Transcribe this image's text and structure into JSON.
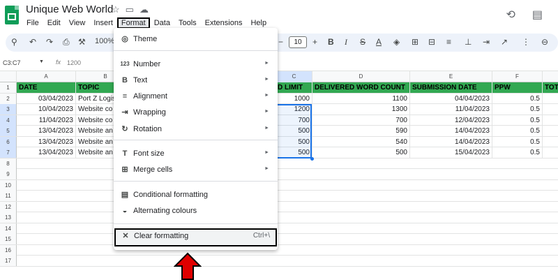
{
  "header": {
    "title": "Unique Web World",
    "menus": [
      "File",
      "Edit",
      "View",
      "Insert",
      "Format",
      "Data",
      "Tools",
      "Extensions",
      "Help"
    ],
    "active_menu": "Format"
  },
  "toolbar": {
    "zoom": "100%",
    "font_size": "10"
  },
  "formula_bar": {
    "name_box": "C3:C7",
    "fx": "fx",
    "value": "1200"
  },
  "grid": {
    "col_headers": [
      "A",
      "B",
      "C",
      "D",
      "E",
      "F"
    ],
    "row_numbers": [
      "1",
      "2",
      "3",
      "4",
      "5",
      "6",
      "7",
      "8",
      "9",
      "10",
      "11",
      "12",
      "13",
      "14",
      "15",
      "16",
      "17"
    ],
    "header_row": [
      "DATE",
      "TOPIC",
      "D LIMIT",
      "DELIVERED WORD COUNT",
      "SUBMISSION DATE",
      "PPW",
      "TOT"
    ],
    "rows": [
      [
        "03/04/2023",
        "Port Z Logis",
        "1000",
        "1100",
        "04/04/2023",
        "0.5"
      ],
      [
        "10/04/2023",
        "Website co",
        "1200",
        "1300",
        "11/04/2023",
        "0.5"
      ],
      [
        "11/04/2023",
        "Website co",
        "700",
        "700",
        "12/04/2023",
        "0.5"
      ],
      [
        "13/04/2023",
        "Website an",
        "500",
        "590",
        "14/04/2023",
        "0.5"
      ],
      [
        "13/04/2023",
        "Website an",
        "500",
        "540",
        "14/04/2023",
        "0.5"
      ],
      [
        "13/04/2023",
        "Website an",
        "500",
        "500",
        "15/04/2023",
        "0.5"
      ]
    ]
  },
  "format_menu": {
    "items": [
      {
        "label": "Theme"
      },
      {
        "label": "Number",
        "submenu": true
      },
      {
        "label": "Text",
        "submenu": true
      },
      {
        "label": "Alignment",
        "submenu": true
      },
      {
        "label": "Wrapping",
        "submenu": true
      },
      {
        "label": "Rotation",
        "submenu": true
      },
      {
        "label": "Font size",
        "submenu": true
      },
      {
        "label": "Merge cells",
        "submenu": true
      },
      {
        "label": "Conditional formatting"
      },
      {
        "label": "Alternating colours"
      },
      {
        "label": "Clear formatting",
        "shortcut": "Ctrl+\\"
      }
    ],
    "icons": [
      "palette-icon",
      "number-format-icon",
      "bold-text-icon",
      "align-icon",
      "wrap-icon",
      "rotate-icon",
      "font-size-icon",
      "merge-cells-icon",
      "conditional-format-icon",
      "alternating-colours-icon",
      "clear-formatting-icon"
    ],
    "icon_glyphs": [
      "◎",
      "123",
      "B",
      "≡",
      "⇥",
      "↻",
      "T",
      "⊞",
      "▤",
      "◒",
      "✕"
    ]
  },
  "colors": {
    "header_green": "#32a852",
    "selection_blue": "#1a73e8",
    "arrow_red": "#e00000"
  }
}
